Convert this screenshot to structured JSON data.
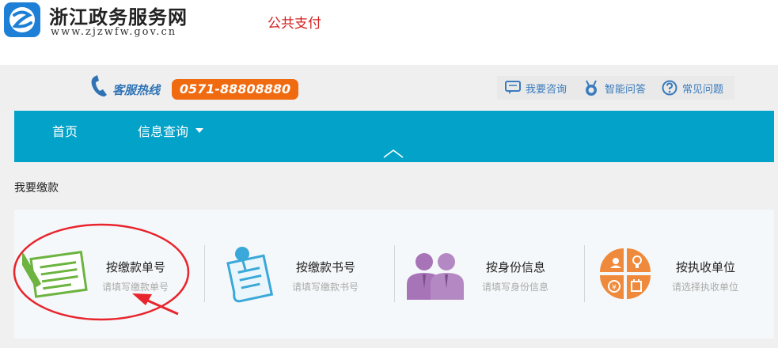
{
  "header": {
    "site_title": "浙江政务服务网",
    "site_url": "www.zjzwfw.gov.cn",
    "page_subtitle": "公共支付"
  },
  "hotline": {
    "label": "客服热线",
    "number": "0571-88808880"
  },
  "top_links": [
    {
      "label": "我要咨询",
      "icon": "chat-icon"
    },
    {
      "label": "智能问答",
      "icon": "robot-icon"
    },
    {
      "label": "常见问题",
      "icon": "question-icon"
    }
  ],
  "nav": {
    "items": [
      {
        "label": "首页"
      },
      {
        "label": "信息查询"
      }
    ]
  },
  "section": {
    "title": "我要缴款"
  },
  "payment_options": [
    {
      "title": "按缴款单号",
      "description": "请填写缴款单号",
      "icon": "document-pencil-icon"
    },
    {
      "title": "按缴款书号",
      "description": "请填写缴款书号",
      "icon": "pinned-note-icon"
    },
    {
      "title": "按身份信息",
      "description": "请填写身份信息",
      "icon": "people-icon"
    },
    {
      "title": "按执收单位",
      "description": "请选择执收单位",
      "icon": "unit-quadrant-icon"
    }
  ],
  "colors": {
    "nav_bg": "#03a3c9",
    "hotline_bg": "#f06a10",
    "subtitle": "#d32020",
    "link": "#3a7bbd",
    "annotation": "#e8242c"
  }
}
